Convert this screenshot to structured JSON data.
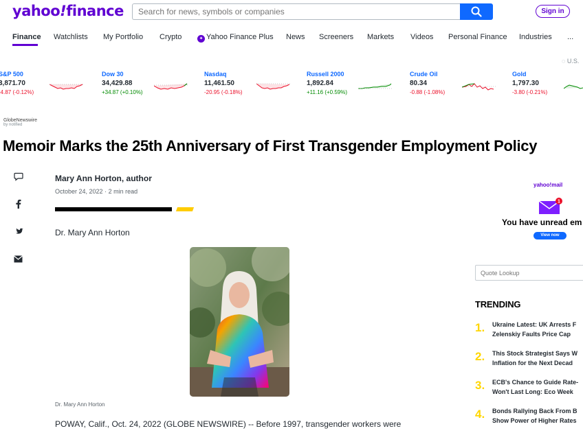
{
  "header": {
    "logo_left": "yahoo",
    "logo_mark": "!",
    "logo_right": "finance",
    "search_placeholder": "Search for news, symbols or companies",
    "signin_label": "Sign in"
  },
  "nav": {
    "items": [
      {
        "label": "Finance",
        "active": true
      },
      {
        "label": "Watchlists"
      },
      {
        "label": "My Portfolio"
      },
      {
        "label": "Crypto"
      },
      {
        "label": "Yahoo Finance Plus"
      },
      {
        "label": "News"
      },
      {
        "label": "Screeners"
      },
      {
        "label": "Markets"
      },
      {
        "label": "Videos"
      },
      {
        "label": "Personal Finance"
      },
      {
        "label": "Industries"
      },
      {
        "label": "..."
      }
    ],
    "region": "U.S."
  },
  "tickers": [
    {
      "name": "S&P 500",
      "price": "3,871.70",
      "change": "-4.87 (-0.12%)",
      "direction": "down"
    },
    {
      "name": "Dow 30",
      "price": "34,429.88",
      "change": "+34.87 (+0.10%)",
      "direction": "up"
    },
    {
      "name": "Nasdaq",
      "price": "11,461.50",
      "change": "-20.95 (-0.18%)",
      "direction": "down"
    },
    {
      "name": "Russell 2000",
      "price": "1,892.84",
      "change": "+11.16 (+0.59%)",
      "direction": "up"
    },
    {
      "name": "Crude Oil",
      "price": "80.34",
      "change": "-0.88 (-1.08%)",
      "direction": "down"
    },
    {
      "name": "Gold",
      "price": "1,797.30",
      "change": "-3.80 (-0.21%)",
      "direction": "down"
    }
  ],
  "article": {
    "source": "GlobeNewswire",
    "source_sub": "by notified",
    "title": "Memoir Marks the 25th Anniversary of First Transgender Employment Policy",
    "author": "Mary Ann Horton, author",
    "date": "October 24, 2022",
    "read_time": "2 min read",
    "lede": "Dr. Mary Ann Horton",
    "caption": "Dr. Mary Ann Horton",
    "body_start": "POWAY, Calif., Oct. 24, 2022 (GLOBE NEWSWIRE) -- Before 1997, transgender workers were"
  },
  "rail": {
    "mail_brand": "yahoo!mail",
    "mail_badge": "1",
    "unread": "You have unread em",
    "view_now": "View now",
    "quote_placeholder": "Quote Lookup",
    "trending_title": "TRENDING",
    "trending": [
      {
        "num": "1.",
        "line1": "Ukraine Latest: UK Arrests F",
        "line2": "Zelenskiy Faults Price Cap"
      },
      {
        "num": "2.",
        "line1": "This Stock Strategist Says W",
        "line2": "Inflation for the Next Decad"
      },
      {
        "num": "3.",
        "line1": "ECB's Chance to Guide Rate-",
        "line2": "Won't Last Long: Eco Week"
      },
      {
        "num": "4.",
        "line1": "Bonds Rallying Back From B",
        "line2": "Show Power of Higher Rates"
      }
    ]
  },
  "colors": {
    "brand": "#6001d2",
    "accent": "#0f69ff",
    "up": "#008a00",
    "down": "#eb0f29",
    "trend_num": "#ffd600"
  }
}
